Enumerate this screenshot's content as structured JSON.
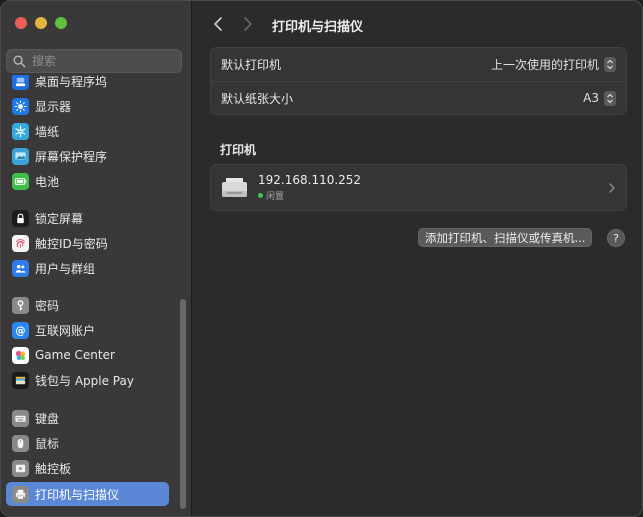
{
  "sidebar": {
    "search_placeholder": "搜索",
    "items": [
      {
        "label": "桌面与程序坞",
        "icon": "dock-icon",
        "color": "#1f6fe0"
      },
      {
        "label": "显示器",
        "icon": "sun-icon",
        "color": "#1f78e8"
      },
      {
        "label": "墙纸",
        "icon": "snowflake-icon",
        "color": "#36a8e0"
      },
      {
        "label": "屏幕保护程序",
        "icon": "screensaver-icon",
        "color": "#3aa2d6"
      },
      {
        "label": "电池",
        "icon": "battery-icon",
        "color": "#3fbe4b"
      },
      {
        "label": "锁定屏幕",
        "icon": "lock-icon",
        "color": "#1c1c1c"
      },
      {
        "label": "触控ID与密码",
        "icon": "fingerprint-icon",
        "color": "#f4f4f4"
      },
      {
        "label": "用户与群组",
        "icon": "users-icon",
        "color": "#2e7bea"
      },
      {
        "label": "密码",
        "icon": "key-icon",
        "color": "#8a8a8a"
      },
      {
        "label": "互联网账户",
        "icon": "at-icon",
        "color": "#2c86f0"
      },
      {
        "label": "Game Center",
        "icon": "game-center-icon",
        "color": "#ffffff"
      },
      {
        "label": "钱包与 Apple Pay",
        "icon": "wallet-icon",
        "color": "#1a1a1a"
      },
      {
        "label": "键盘",
        "icon": "keyboard-icon",
        "color": "#8a8a8a"
      },
      {
        "label": "鼠标",
        "icon": "mouse-icon",
        "color": "#8a8a8a"
      },
      {
        "label": "触控板",
        "icon": "trackpad-icon",
        "color": "#8a8a8a"
      },
      {
        "label": "打印机与扫描仪",
        "icon": "printer-icon",
        "color": "#8a8a8a"
      }
    ],
    "active_index": 15
  },
  "header": {
    "title": "打印机与扫描仪"
  },
  "defaults": {
    "printer_label": "默认打印机",
    "printer_value": "上一次使用的打印机",
    "paper_label": "默认纸张大小",
    "paper_value": "A3"
  },
  "printers_section": {
    "title": "打印机",
    "printers": [
      {
        "name": "192.168.110.252",
        "status": "闲置"
      }
    ],
    "add_button": "添加打印机、扫描仪或传真机...",
    "help_button": "?"
  },
  "colors": {
    "accent": "#5b88d6",
    "status_idle": "#3fc54a"
  }
}
